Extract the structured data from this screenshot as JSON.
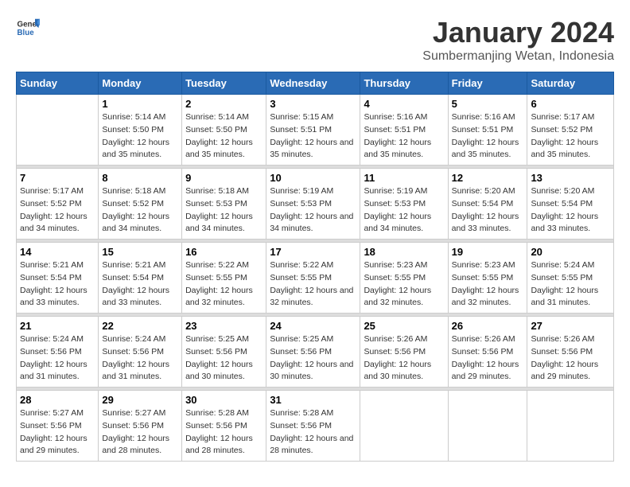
{
  "header": {
    "logo": {
      "general": "General",
      "blue": "Blue"
    },
    "title": "January 2024",
    "subtitle": "Sumbermanjing Wetan, Indonesia"
  },
  "weekdays": [
    "Sunday",
    "Monday",
    "Tuesday",
    "Wednesday",
    "Thursday",
    "Friday",
    "Saturday"
  ],
  "weeks": [
    [
      {
        "day": "",
        "sunrise": "",
        "sunset": "",
        "daylight": ""
      },
      {
        "day": "1",
        "sunrise": "Sunrise: 5:14 AM",
        "sunset": "Sunset: 5:50 PM",
        "daylight": "Daylight: 12 hours and 35 minutes."
      },
      {
        "day": "2",
        "sunrise": "Sunrise: 5:14 AM",
        "sunset": "Sunset: 5:50 PM",
        "daylight": "Daylight: 12 hours and 35 minutes."
      },
      {
        "day": "3",
        "sunrise": "Sunrise: 5:15 AM",
        "sunset": "Sunset: 5:51 PM",
        "daylight": "Daylight: 12 hours and 35 minutes."
      },
      {
        "day": "4",
        "sunrise": "Sunrise: 5:16 AM",
        "sunset": "Sunset: 5:51 PM",
        "daylight": "Daylight: 12 hours and 35 minutes."
      },
      {
        "day": "5",
        "sunrise": "Sunrise: 5:16 AM",
        "sunset": "Sunset: 5:51 PM",
        "daylight": "Daylight: 12 hours and 35 minutes."
      },
      {
        "day": "6",
        "sunrise": "Sunrise: 5:17 AM",
        "sunset": "Sunset: 5:52 PM",
        "daylight": "Daylight: 12 hours and 35 minutes."
      }
    ],
    [
      {
        "day": "7",
        "sunrise": "Sunrise: 5:17 AM",
        "sunset": "Sunset: 5:52 PM",
        "daylight": "Daylight: 12 hours and 34 minutes."
      },
      {
        "day": "8",
        "sunrise": "Sunrise: 5:18 AM",
        "sunset": "Sunset: 5:52 PM",
        "daylight": "Daylight: 12 hours and 34 minutes."
      },
      {
        "day": "9",
        "sunrise": "Sunrise: 5:18 AM",
        "sunset": "Sunset: 5:53 PM",
        "daylight": "Daylight: 12 hours and 34 minutes."
      },
      {
        "day": "10",
        "sunrise": "Sunrise: 5:19 AM",
        "sunset": "Sunset: 5:53 PM",
        "daylight": "Daylight: 12 hours and 34 minutes."
      },
      {
        "day": "11",
        "sunrise": "Sunrise: 5:19 AM",
        "sunset": "Sunset: 5:53 PM",
        "daylight": "Daylight: 12 hours and 34 minutes."
      },
      {
        "day": "12",
        "sunrise": "Sunrise: 5:20 AM",
        "sunset": "Sunset: 5:54 PM",
        "daylight": "Daylight: 12 hours and 33 minutes."
      },
      {
        "day": "13",
        "sunrise": "Sunrise: 5:20 AM",
        "sunset": "Sunset: 5:54 PM",
        "daylight": "Daylight: 12 hours and 33 minutes."
      }
    ],
    [
      {
        "day": "14",
        "sunrise": "Sunrise: 5:21 AM",
        "sunset": "Sunset: 5:54 PM",
        "daylight": "Daylight: 12 hours and 33 minutes."
      },
      {
        "day": "15",
        "sunrise": "Sunrise: 5:21 AM",
        "sunset": "Sunset: 5:54 PM",
        "daylight": "Daylight: 12 hours and 33 minutes."
      },
      {
        "day": "16",
        "sunrise": "Sunrise: 5:22 AM",
        "sunset": "Sunset: 5:55 PM",
        "daylight": "Daylight: 12 hours and 32 minutes."
      },
      {
        "day": "17",
        "sunrise": "Sunrise: 5:22 AM",
        "sunset": "Sunset: 5:55 PM",
        "daylight": "Daylight: 12 hours and 32 minutes."
      },
      {
        "day": "18",
        "sunrise": "Sunrise: 5:23 AM",
        "sunset": "Sunset: 5:55 PM",
        "daylight": "Daylight: 12 hours and 32 minutes."
      },
      {
        "day": "19",
        "sunrise": "Sunrise: 5:23 AM",
        "sunset": "Sunset: 5:55 PM",
        "daylight": "Daylight: 12 hours and 32 minutes."
      },
      {
        "day": "20",
        "sunrise": "Sunrise: 5:24 AM",
        "sunset": "Sunset: 5:55 PM",
        "daylight": "Daylight: 12 hours and 31 minutes."
      }
    ],
    [
      {
        "day": "21",
        "sunrise": "Sunrise: 5:24 AM",
        "sunset": "Sunset: 5:56 PM",
        "daylight": "Daylight: 12 hours and 31 minutes."
      },
      {
        "day": "22",
        "sunrise": "Sunrise: 5:24 AM",
        "sunset": "Sunset: 5:56 PM",
        "daylight": "Daylight: 12 hours and 31 minutes."
      },
      {
        "day": "23",
        "sunrise": "Sunrise: 5:25 AM",
        "sunset": "Sunset: 5:56 PM",
        "daylight": "Daylight: 12 hours and 30 minutes."
      },
      {
        "day": "24",
        "sunrise": "Sunrise: 5:25 AM",
        "sunset": "Sunset: 5:56 PM",
        "daylight": "Daylight: 12 hours and 30 minutes."
      },
      {
        "day": "25",
        "sunrise": "Sunrise: 5:26 AM",
        "sunset": "Sunset: 5:56 PM",
        "daylight": "Daylight: 12 hours and 30 minutes."
      },
      {
        "day": "26",
        "sunrise": "Sunrise: 5:26 AM",
        "sunset": "Sunset: 5:56 PM",
        "daylight": "Daylight: 12 hours and 29 minutes."
      },
      {
        "day": "27",
        "sunrise": "Sunrise: 5:26 AM",
        "sunset": "Sunset: 5:56 PM",
        "daylight": "Daylight: 12 hours and 29 minutes."
      }
    ],
    [
      {
        "day": "28",
        "sunrise": "Sunrise: 5:27 AM",
        "sunset": "Sunset: 5:56 PM",
        "daylight": "Daylight: 12 hours and 29 minutes."
      },
      {
        "day": "29",
        "sunrise": "Sunrise: 5:27 AM",
        "sunset": "Sunset: 5:56 PM",
        "daylight": "Daylight: 12 hours and 28 minutes."
      },
      {
        "day": "30",
        "sunrise": "Sunrise: 5:28 AM",
        "sunset": "Sunset: 5:56 PM",
        "daylight": "Daylight: 12 hours and 28 minutes."
      },
      {
        "day": "31",
        "sunrise": "Sunrise: 5:28 AM",
        "sunset": "Sunset: 5:56 PM",
        "daylight": "Daylight: 12 hours and 28 minutes."
      },
      {
        "day": "",
        "sunrise": "",
        "sunset": "",
        "daylight": ""
      },
      {
        "day": "",
        "sunrise": "",
        "sunset": "",
        "daylight": ""
      },
      {
        "day": "",
        "sunrise": "",
        "sunset": "",
        "daylight": ""
      }
    ]
  ]
}
